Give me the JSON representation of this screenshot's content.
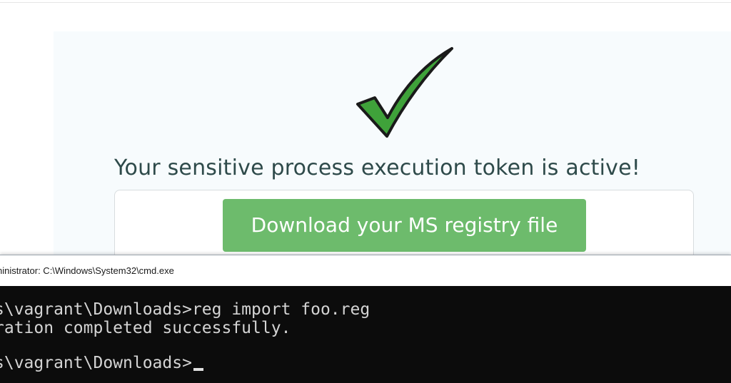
{
  "page": {
    "headline": "Your sensitive process execution token is active!",
    "download_button_label": "Download your MS registry file",
    "success_icon": "checkmark-icon"
  },
  "cmd": {
    "title": "ninistrator: C:\\Windows\\System32\\cmd.exe",
    "lines": [
      "s\\vagrant\\Downloads>reg import foo.reg",
      "ration completed successfully.",
      "",
      "s\\vagrant\\Downloads>"
    ]
  },
  "colors": {
    "button_green": "#6dbb6c",
    "check_green": "#3fa23a",
    "headline_text": "#2e4a4a",
    "console_bg": "#0c0c0c"
  }
}
